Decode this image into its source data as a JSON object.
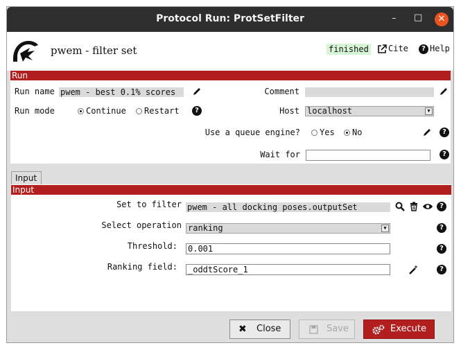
{
  "window": {
    "title": "Protocol Run: ProtSetFilter",
    "minimize_glyph": "–",
    "maximize_glyph": "□",
    "close_glyph": "✕"
  },
  "header": {
    "protocol_name": "pwem - filter set",
    "status": "finished",
    "cite_label": "Cite",
    "help_label": "Help"
  },
  "run_section": {
    "title": "Run",
    "run_name_label": "Run name",
    "run_name_value": "pwem - best 0.1% scores",
    "comment_label": "Comment",
    "comment_value": "",
    "run_mode_label": "Run mode",
    "run_mode_options": [
      "Continue",
      "Restart"
    ],
    "run_mode_selected": "Continue",
    "host_label": "Host",
    "host_value": "localhost",
    "queue_label": "Use a queue engine?",
    "queue_options": [
      "Yes",
      "No"
    ],
    "queue_selected": "No",
    "wait_for_label": "Wait for",
    "wait_for_value": ""
  },
  "input_tab": {
    "tab_label": "Input",
    "section_title": "Input",
    "set_to_filter_label": "Set to filter",
    "set_to_filter_value": "pwem - all docking poses.outputSet",
    "select_operation_label": "Select operation",
    "select_operation_value": "ranking",
    "threshold_label": "Threshold:",
    "threshold_value": "0.001",
    "ranking_field_label": "Ranking field:",
    "ranking_field_value": "_oddtScore_1"
  },
  "footer": {
    "close_label": "Close",
    "save_label": "Save",
    "execute_label": "Execute"
  },
  "colors": {
    "section_bar": "#b11f1f",
    "execute_button": "#b11f1f",
    "status_bg": "#d6f5d6",
    "titlebar": "#2e2e2e"
  }
}
